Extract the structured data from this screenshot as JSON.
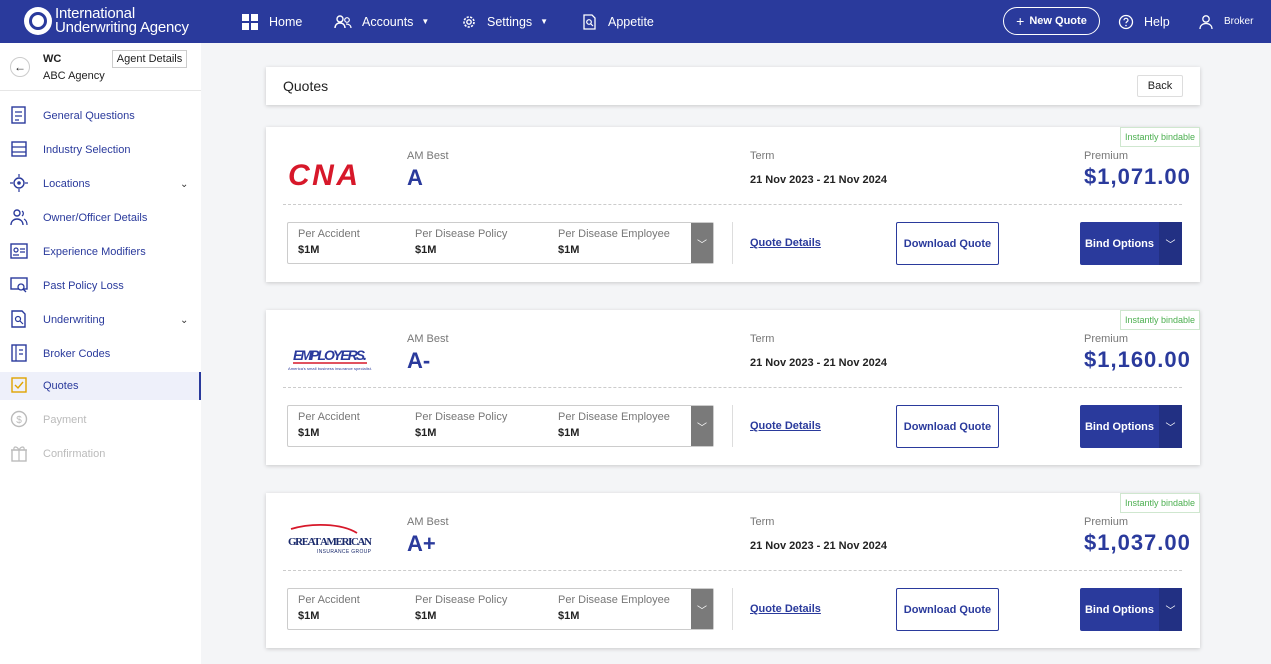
{
  "brand": {
    "line1": "International",
    "line2": "Underwriting Agency"
  },
  "nav": {
    "home": "Home",
    "accounts": "Accounts",
    "settings": "Settings",
    "appetite": "Appetite",
    "new_quote": "New Quote",
    "help": "Help",
    "user": "Broker"
  },
  "sidebar": {
    "policy_type": "WC",
    "agency": "ABC Agency",
    "agent_details": "Agent Details",
    "items": [
      {
        "label": "General Questions"
      },
      {
        "label": "Industry Selection"
      },
      {
        "label": "Locations"
      },
      {
        "label": "Owner/Officer Details"
      },
      {
        "label": "Experience Modifiers"
      },
      {
        "label": "Past Policy Loss"
      },
      {
        "label": "Underwriting"
      },
      {
        "label": "Broker Codes"
      },
      {
        "label": "Quotes"
      },
      {
        "label": "Payment"
      },
      {
        "label": "Confirmation"
      }
    ]
  },
  "quotes_header": {
    "title": "Quotes",
    "back": "Back"
  },
  "labels": {
    "am_best": "AM Best",
    "term": "Term",
    "premium": "Premium",
    "instantly_bindable": "Instantly bindable",
    "per_accident": "Per Accident",
    "per_disease_policy": "Per Disease Policy",
    "per_disease_employee": "Per Disease Employee",
    "quote_details": "Quote Details",
    "download_quote": "Download Quote",
    "bind_options": "Bind Options"
  },
  "quotes": [
    {
      "carrier": "CNA",
      "rating": "A",
      "term": "21 Nov 2023 - 21 Nov 2024",
      "premium": "$1,071.00",
      "per_accident": "$1M",
      "per_disease_policy": "$1M",
      "per_disease_employee": "$1M"
    },
    {
      "carrier": "EMPLOYERS.",
      "carrier_tagline": "America's small business insurance specialist.",
      "rating": "A-",
      "term": "21 Nov 2023 - 21 Nov 2024",
      "premium": "$1,160.00",
      "per_accident": "$1M",
      "per_disease_policy": "$1M",
      "per_disease_employee": "$1M"
    },
    {
      "carrier": "GREAT AMERICAN",
      "carrier_tagline": "INSURANCE GROUP",
      "rating": "A+",
      "term": "21 Nov 2023 - 21 Nov 2024",
      "premium": "$1,037.00",
      "per_accident": "$1M",
      "per_disease_policy": "$1M",
      "per_disease_employee": "$1M"
    }
  ]
}
